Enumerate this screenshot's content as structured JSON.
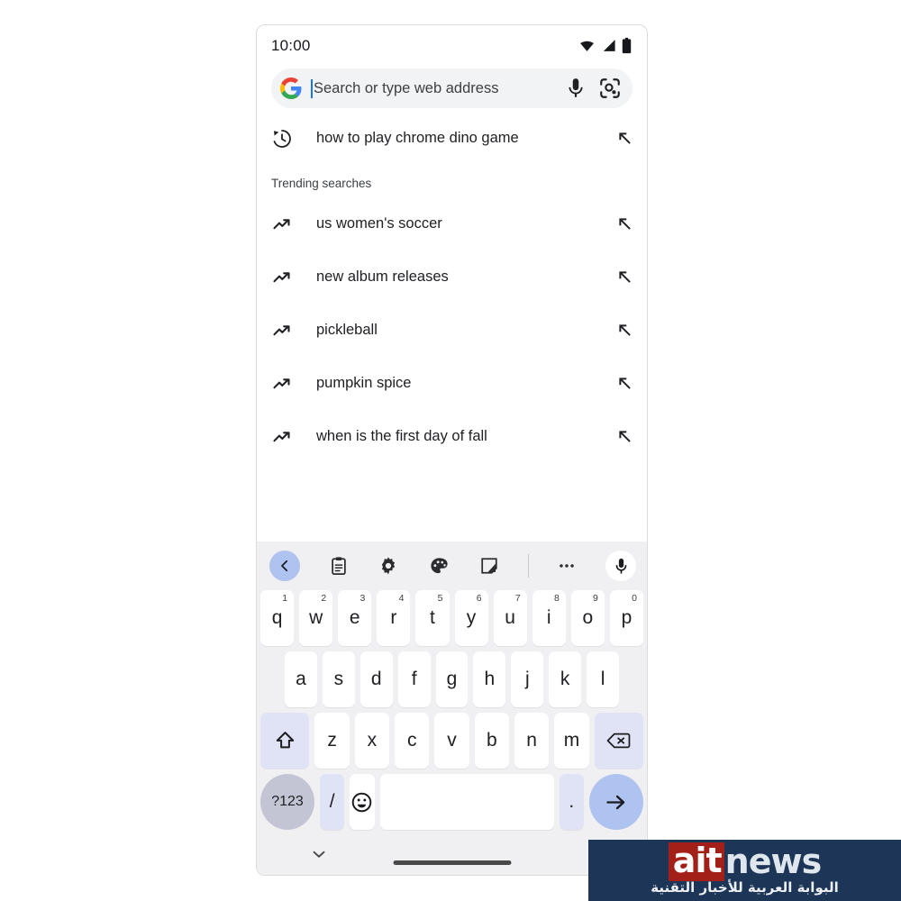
{
  "statusbar": {
    "time": "10:00",
    "icons": [
      "wifi-icon",
      "cell-signal-icon",
      "battery-icon"
    ]
  },
  "search": {
    "logo": "google-g-icon",
    "value": "",
    "placeholder": "Search or type web address",
    "mic_icon": "microphone-icon",
    "lens_icon": "google-lens-icon"
  },
  "suggestions": {
    "history": [
      {
        "icon": "history-clock-icon",
        "text": "how to play chrome dino game",
        "action_icon": "arrow-up-left-icon"
      }
    ],
    "section_label": "Trending searches",
    "trending": [
      {
        "icon": "trending-up-icon",
        "text": "us women's soccer",
        "action_icon": "arrow-up-left-icon"
      },
      {
        "icon": "trending-up-icon",
        "text": "new album releases",
        "action_icon": "arrow-up-left-icon"
      },
      {
        "icon": "trending-up-icon",
        "text": "pickleball",
        "action_icon": "arrow-up-left-icon"
      },
      {
        "icon": "trending-up-icon",
        "text": "pumpkin spice",
        "action_icon": "arrow-up-left-icon"
      },
      {
        "icon": "trending-up-icon",
        "text": "when is the first day of fall",
        "action_icon": "arrow-up-left-icon"
      }
    ]
  },
  "keyboard": {
    "toolbar": [
      {
        "name": "back-chevron-icon",
        "label": ""
      },
      {
        "name": "clipboard-icon",
        "label": ""
      },
      {
        "name": "gear-icon",
        "label": ""
      },
      {
        "name": "palette-icon",
        "label": ""
      },
      {
        "name": "sticker-icon",
        "label": ""
      },
      {
        "name": "overflow-dots-icon",
        "label": ""
      },
      {
        "name": "microphone-icon",
        "label": ""
      }
    ],
    "row1": [
      {
        "key": "q",
        "hint": "1"
      },
      {
        "key": "w",
        "hint": "2"
      },
      {
        "key": "e",
        "hint": "3"
      },
      {
        "key": "r",
        "hint": "4"
      },
      {
        "key": "t",
        "hint": "5"
      },
      {
        "key": "y",
        "hint": "6"
      },
      {
        "key": "u",
        "hint": "7"
      },
      {
        "key": "i",
        "hint": "8"
      },
      {
        "key": "o",
        "hint": "9"
      },
      {
        "key": "p",
        "hint": "0"
      }
    ],
    "row2": [
      {
        "key": "a"
      },
      {
        "key": "s"
      },
      {
        "key": "d"
      },
      {
        "key": "f"
      },
      {
        "key": "g"
      },
      {
        "key": "h"
      },
      {
        "key": "j"
      },
      {
        "key": "k"
      },
      {
        "key": "l"
      }
    ],
    "row3": [
      {
        "key": "shift",
        "icon": "shift-arrow-icon"
      },
      {
        "key": "z"
      },
      {
        "key": "x"
      },
      {
        "key": "c"
      },
      {
        "key": "v"
      },
      {
        "key": "b"
      },
      {
        "key": "n"
      },
      {
        "key": "m"
      },
      {
        "key": "backspace",
        "icon": "backspace-icon"
      }
    ],
    "row4": {
      "symbols_label": "?123",
      "slash_label": "/",
      "emoji_icon": "emoji-smiley-icon",
      "space_label": "",
      "period_label": ".",
      "enter_icon": "arrow-right-icon"
    }
  },
  "navbar": {
    "hide_keyboard_icon": "chevron-down-icon",
    "home_indicator": "home-gesture-bar"
  },
  "watermark": {
    "brand_red": "ait",
    "brand_light": "news",
    "subtitle": "البوابة العربية للأخبار التقنية",
    "bg_color": "#1d3557",
    "accent_color": "#a32018"
  }
}
